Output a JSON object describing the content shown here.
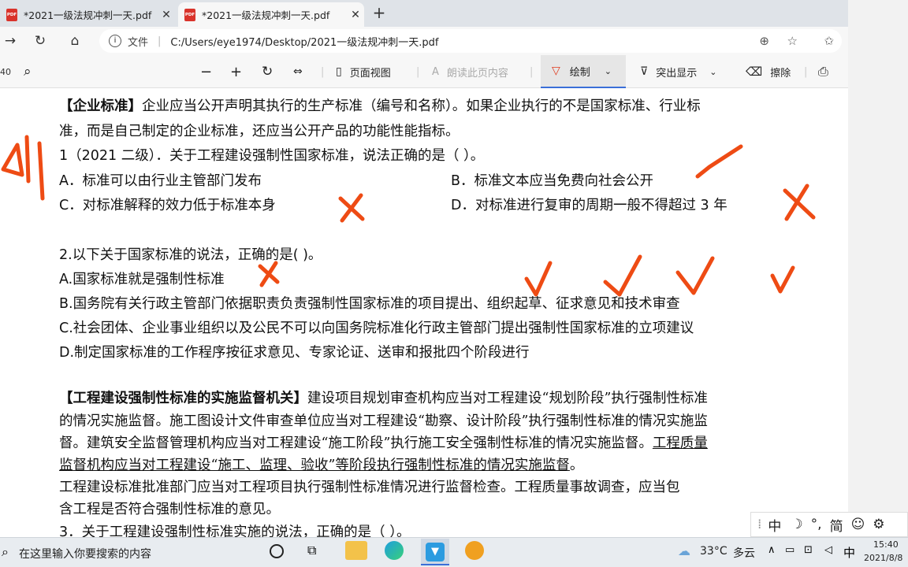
{
  "tabs": [
    {
      "title": "*2021一级法规冲刺一天.pdf",
      "icon": "pdf-icon"
    },
    {
      "title": "*2021一级法规冲刺一天.pdf",
      "icon": "pdf-icon"
    }
  ],
  "address": {
    "prefix": "文件",
    "path": "C:/Users/eye1974/Desktop/2021一级法规冲刺一天.pdf"
  },
  "pdf_toolbar": {
    "page_fragment": "40",
    "page_view": "页面视图",
    "read_aloud": "朗读此页内容",
    "draw": "绘制",
    "highlight": "突出显示",
    "erase": "擦除"
  },
  "doc": {
    "l1_b": "【企业标准】",
    "l1": "企业应当公开声明其执行的生产标准（编号和名称）。如果企业执行的不是国家标准、行业标",
    "l2": "准，而是自己制定的企业标准，还应当公开产品的功能性能指标。",
    "q1": "1（2021 二级）．关于工程建设强制性国家标准，说法正确的是（          ）。",
    "q1a": "A．标准可以由行业主管部门发布",
    "q1b": "B．标准文本应当免费向社会公开",
    "q1c": "C．对标准解释的效力低于标准本身",
    "q1d": "D．对标准进行复审的周期一般不得超过 3 年",
    "q2": "2.以下关于国家标准的说法，正确的是(      )。",
    "q2a": "A.国家标准就是强制性标准",
    "q2b": "B.国务院有关行政主管部门依据职责负责强制性国家标准的项目提出、组织起草、征求意见和技术审查",
    "q2c": "C.社会团体、企业事业组织以及公民不可以向国务院标准化行政主管部门提出强制性国家标准的立项建议",
    "q2d": "D.制定国家标准的工作程序按征求意见、专家论证、送审和报批四个阶段进行",
    "s2_b": "【工程建设强制性标准的实施监督机关】",
    "s2": "建设项目规划审查机构应当对工程建设“规划阶段”执行强制性标准",
    "s3": "的情况实施监督。施工图设计文件审查单位应当对工程建设“勘察、设计阶段”执行强制性标准的情况实施监",
    "s4": "督。建筑安全监督管理机构应当对工程建设“施工阶段”执行施工安全强制性标准的情况实施监督。",
    "s4u": "工程质量",
    "s5u": "监督机构应当对工程建设“施工、监理、验收”等阶段执行强制性标准的情况实施监督",
    "s5": "。",
    "s6": "    工程建设标准批准部门应当对工程项目执行强制性标准情况进行监督检查。工程质量事故调查，应当包",
    "s7": "含工程是否符合强制性标准的意见。",
    "q3": "3．关于工程建设强制性标准实施的说法，正确的是（    ）。"
  },
  "ime": {
    "mode": "中",
    "punct": "°,",
    "script": "简"
  },
  "taskbar": {
    "search_placeholder": "在这里输入你要搜索的内容",
    "weather_temp": "33°C",
    "weather_desc": "多云",
    "lang": "中",
    "time": "15:40",
    "date": "2021/8/8"
  },
  "colors": {
    "ink": "#ee4b14",
    "tab_bg": "#dfe3e8",
    "toolbar_bg": "#f7f7f7",
    "accent": "#3a6fd8"
  }
}
